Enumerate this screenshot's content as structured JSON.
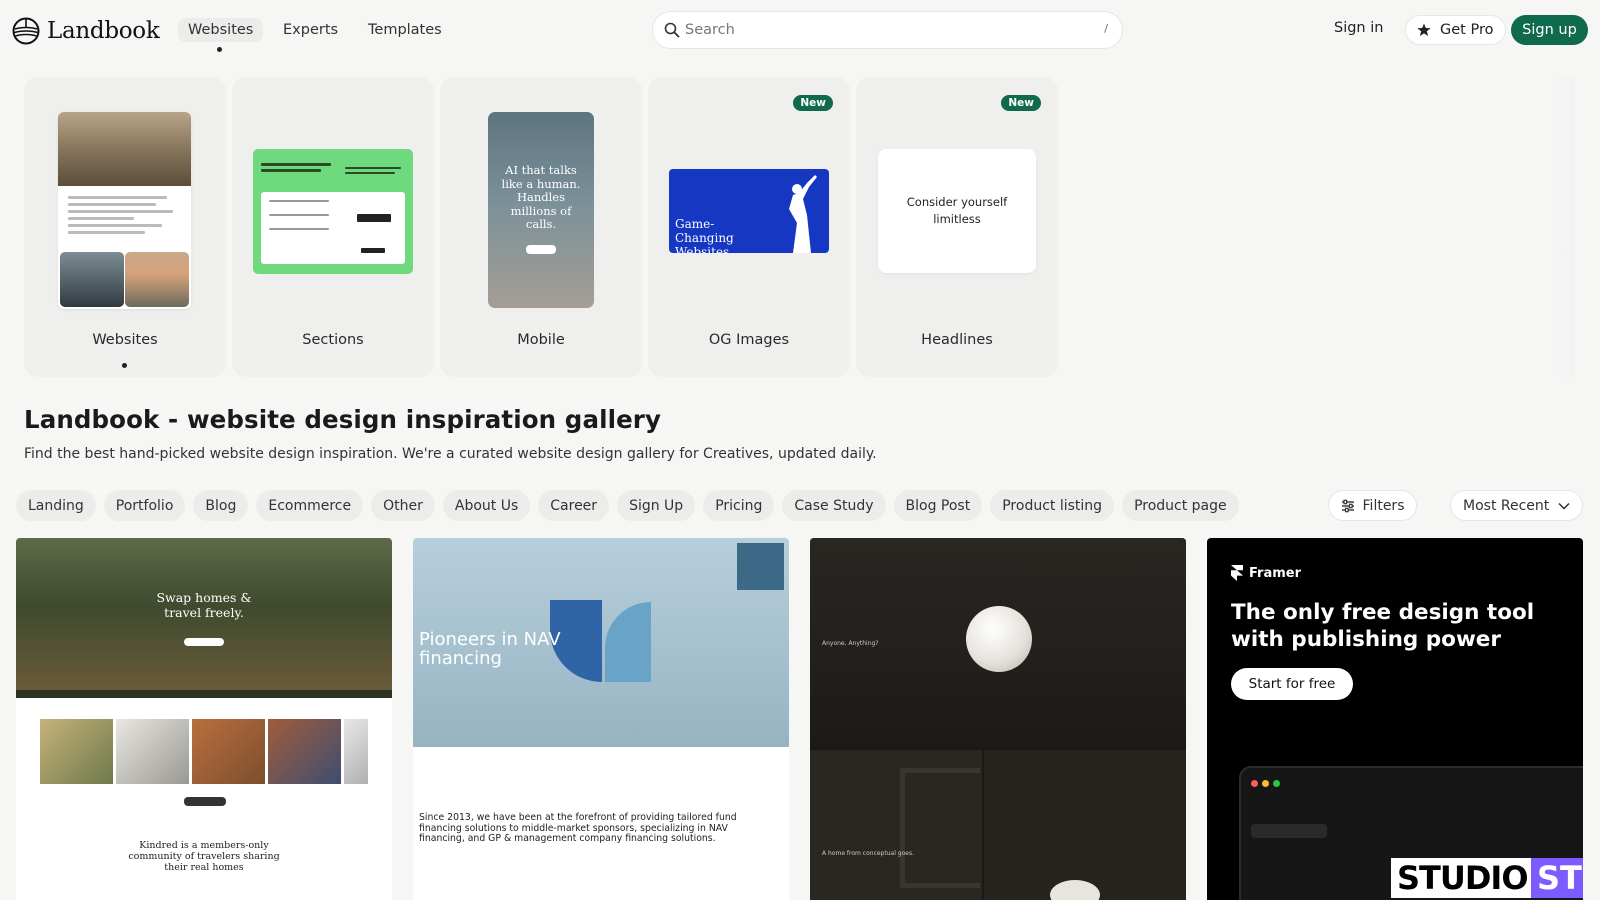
{
  "nav": {
    "brand": "Landbook",
    "links": [
      "Websites",
      "Experts",
      "Templates"
    ],
    "active_link": "Websites",
    "search_placeholder": "Search",
    "search_shortcut": "/",
    "sign_in": "Sign in",
    "get_pro": "Get Pro",
    "sign_up": "Sign up",
    "accent_color": "#0f6a4e"
  },
  "categories": [
    {
      "label": "Websites",
      "active": true
    },
    {
      "label": "Sections"
    },
    {
      "label": "Mobile",
      "preview_text": "AI that talks like a human. Handles millions of calls."
    },
    {
      "label": "OG Images",
      "badge": "New",
      "preview_text": "Game-Changing Websites"
    },
    {
      "label": "Headlines",
      "badge": "New",
      "preview_text": "Consider yourself limitless"
    }
  ],
  "page": {
    "title": "Landbook - website design inspiration gallery",
    "subtitle": "Find the best hand-picked website design inspiration. We're a curated website design gallery for Creatives, updated daily."
  },
  "filters": {
    "chips": [
      "Landing",
      "Portfolio",
      "Blog",
      "Ecommerce",
      "Other",
      "About Us",
      "Career",
      "Sign Up",
      "Pricing",
      "Case Study",
      "Blog Post",
      "Product listing",
      "Product page"
    ],
    "filters_label": "Filters",
    "sort_label": "Most Recent"
  },
  "gallery": {
    "card1": {
      "hero_title": "Swap homes & travel freely.",
      "body": "Kindred is a members-only community of travelers sharing their real homes"
    },
    "card2": {
      "hero_title": "Pioneers in NAV financing",
      "body": "Since 2013, we have been at the forefront of providing tailored fund financing solutions to middle-market sponsors, specializing in NAV financing, and GP & management company financing solutions."
    },
    "card3": {
      "caption_top": "Anyone, Anything?",
      "caption_bottom": "A home from conceptual goes."
    },
    "card4": {
      "brand": "Framer",
      "title": "The only free design tool with publishing power",
      "cta": "Start for free",
      "studio_word": "STUDIO",
      "studio_word_cut": "ST"
    }
  }
}
